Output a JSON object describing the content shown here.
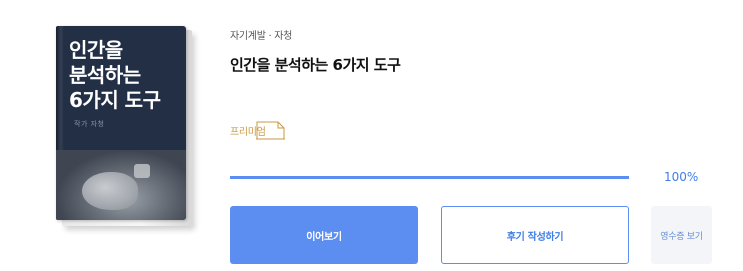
{
  "book": {
    "cover": {
      "title_lines": [
        "인간을",
        "분석하는",
        "6가지 도구"
      ],
      "author": "작가 자청",
      "background_color": "#232f45"
    },
    "category": "자기계발 · 자청",
    "title": "인간을 분석하는 6가지 도구",
    "badge": {
      "label": "프리미엄",
      "color": "#c99a46",
      "icon": "folded-page-icon"
    }
  },
  "progress": {
    "value": 1.0,
    "label": "100%",
    "color": "#5b8ef0"
  },
  "actions": {
    "continue_label": "이어보기",
    "review_label": "후기 작성하기",
    "receipt_label": "영수증 보기",
    "accent_color": "#5b8ef0"
  }
}
